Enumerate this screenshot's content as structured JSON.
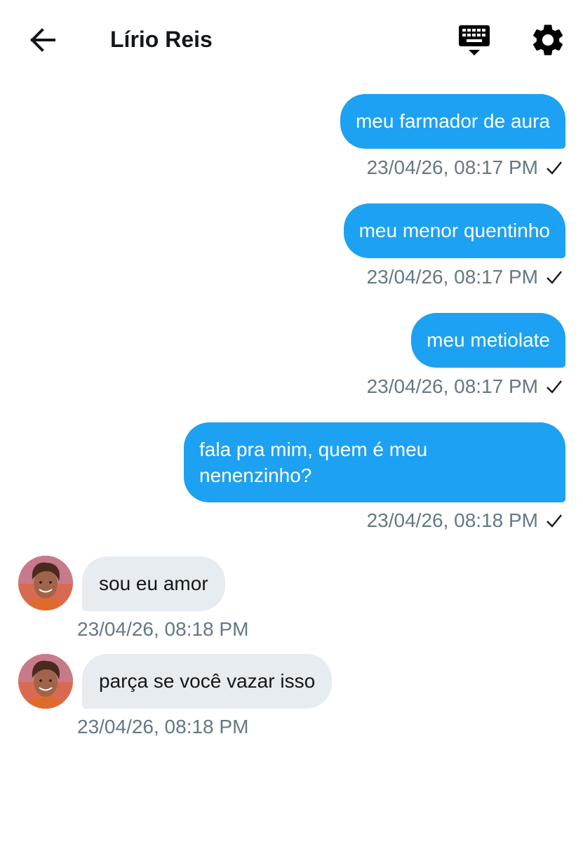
{
  "header": {
    "title": "Lírio Reis",
    "back_icon": "arrow-left-icon",
    "keyboard_icon": "keyboard-hide-icon",
    "settings_icon": "gear-icon"
  },
  "colors": {
    "sent_bubble": "#1da1f2",
    "received_bubble": "#e6ecf0",
    "timestamp": "#657786"
  },
  "messages": [
    {
      "direction": "sent",
      "lines": [
        "meu farmador de aura"
      ],
      "timestamp": "23/04/26, 08:17 PM",
      "status_icon": "check-icon"
    },
    {
      "direction": "sent",
      "lines": [
        "meu menor quentinho"
      ],
      "timestamp": "23/04/26, 08:17 PM",
      "status_icon": "check-icon"
    },
    {
      "direction": "sent",
      "lines": [
        "meu metiolate"
      ],
      "timestamp": "23/04/26, 08:17 PM",
      "status_icon": "check-icon"
    },
    {
      "direction": "sent",
      "lines": [
        "fala pra mim, quem é meu",
        "nenenzinho?"
      ],
      "timestamp": "23/04/26, 08:18 PM",
      "status_icon": "check-icon"
    },
    {
      "direction": "received",
      "lines": [
        "sou eu amor"
      ],
      "timestamp": "23/04/26, 08:18 PM"
    },
    {
      "direction": "received",
      "lines": [
        "parça se você vazar isso"
      ],
      "timestamp": "23/04/26, 08:18 PM"
    }
  ]
}
